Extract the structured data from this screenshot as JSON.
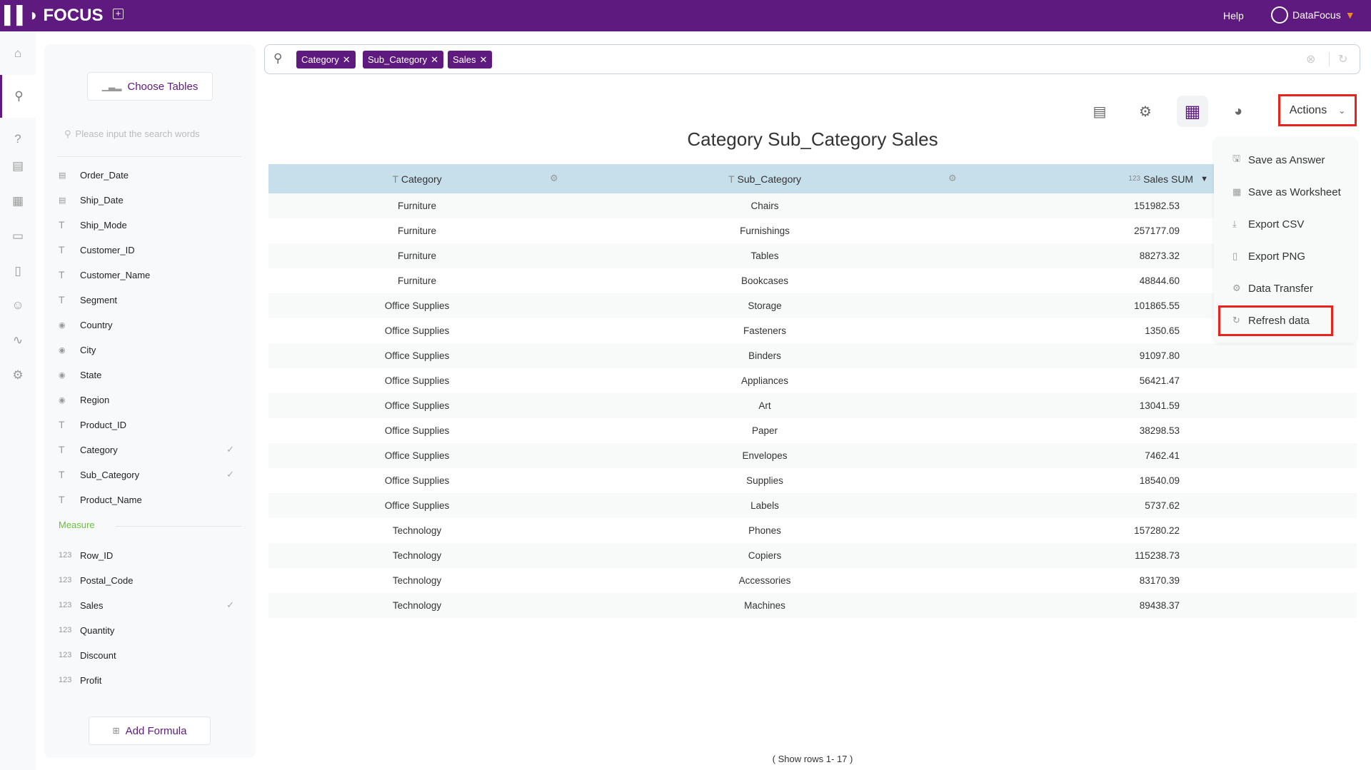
{
  "app": {
    "logo": "FOCUS",
    "help": "Help",
    "user": "DataFocus",
    "accent": "#5e1a7e",
    "highlight": "#e8231d"
  },
  "rail": [
    "home-icon",
    "search-icon",
    "help-icon",
    "presentation-icon",
    "table-icon",
    "folder-icon",
    "clipboard-icon",
    "user-icon",
    "activity-icon",
    "settings-icon"
  ],
  "panel": {
    "choose_tables": "Choose Tables",
    "search_placeholder": "Please input the search words",
    "dimensions": [
      {
        "name": "Order_Date",
        "type": "date",
        "checked": false
      },
      {
        "name": "Ship_Date",
        "type": "date",
        "checked": false
      },
      {
        "name": "Ship_Mode",
        "type": "text",
        "checked": false
      },
      {
        "name": "Customer_ID",
        "type": "text",
        "checked": false
      },
      {
        "name": "Customer_Name",
        "type": "text",
        "checked": false
      },
      {
        "name": "Segment",
        "type": "text",
        "checked": false
      },
      {
        "name": "Country",
        "type": "geo",
        "checked": false
      },
      {
        "name": "City",
        "type": "geo",
        "checked": false
      },
      {
        "name": "State",
        "type": "geo",
        "checked": false
      },
      {
        "name": "Region",
        "type": "geo",
        "checked": false
      },
      {
        "name": "Product_ID",
        "type": "text",
        "checked": false
      },
      {
        "name": "Category",
        "type": "text",
        "checked": true
      },
      {
        "name": "Sub_Category",
        "type": "text",
        "checked": true
      },
      {
        "name": "Product_Name",
        "type": "text",
        "checked": false
      }
    ],
    "measure_label": "Measure",
    "measures": [
      {
        "name": "Row_ID",
        "checked": false
      },
      {
        "name": "Postal_Code",
        "checked": false
      },
      {
        "name": "Sales",
        "checked": true
      },
      {
        "name": "Quantity",
        "checked": false
      },
      {
        "name": "Discount",
        "checked": false
      },
      {
        "name": "Profit",
        "checked": false
      }
    ],
    "add_formula": "Add Formula"
  },
  "search": {
    "tags": [
      "Category",
      "Sub_Category",
      "Sales"
    ]
  },
  "toolbar": {
    "actions": "Actions"
  },
  "title": "Category Sub_Category Sales",
  "table": {
    "headers": [
      "Category",
      "Sub_Category",
      "Sales SUM"
    ],
    "rows": [
      [
        "Furniture",
        "Chairs",
        "151982.53"
      ],
      [
        "Furniture",
        "Furnishings",
        "257177.09"
      ],
      [
        "Furniture",
        "Tables",
        "88273.32"
      ],
      [
        "Furniture",
        "Bookcases",
        "48844.60"
      ],
      [
        "Office Supplies",
        "Storage",
        "101865.55"
      ],
      [
        "Office Supplies",
        "Fasteners",
        "1350.65"
      ],
      [
        "Office Supplies",
        "Binders",
        "91097.80"
      ],
      [
        "Office Supplies",
        "Appliances",
        "56421.47"
      ],
      [
        "Office Supplies",
        "Art",
        "13041.59"
      ],
      [
        "Office Supplies",
        "Paper",
        "38298.53"
      ],
      [
        "Office Supplies",
        "Envelopes",
        "7462.41"
      ],
      [
        "Office Supplies",
        "Supplies",
        "18540.09"
      ],
      [
        "Office Supplies",
        "Labels",
        "5737.62"
      ],
      [
        "Technology",
        "Phones",
        "157280.22"
      ],
      [
        "Technology",
        "Copiers",
        "115238.73"
      ],
      [
        "Technology",
        "Accessories",
        "83170.39"
      ],
      [
        "Technology",
        "Machines",
        "89438.37"
      ]
    ]
  },
  "menu": [
    {
      "label": "Save as Answer",
      "icon": "save-icon"
    },
    {
      "label": "Save as Worksheet",
      "icon": "grid-icon"
    },
    {
      "label": "Export CSV",
      "icon": "download-icon"
    },
    {
      "label": "Export PNG",
      "icon": "image-file-icon"
    },
    {
      "label": "Data Transfer",
      "icon": "gear-icon"
    },
    {
      "label": "Refresh data",
      "icon": "refresh-icon"
    }
  ],
  "footer": "( Show rows 1- 17 )"
}
